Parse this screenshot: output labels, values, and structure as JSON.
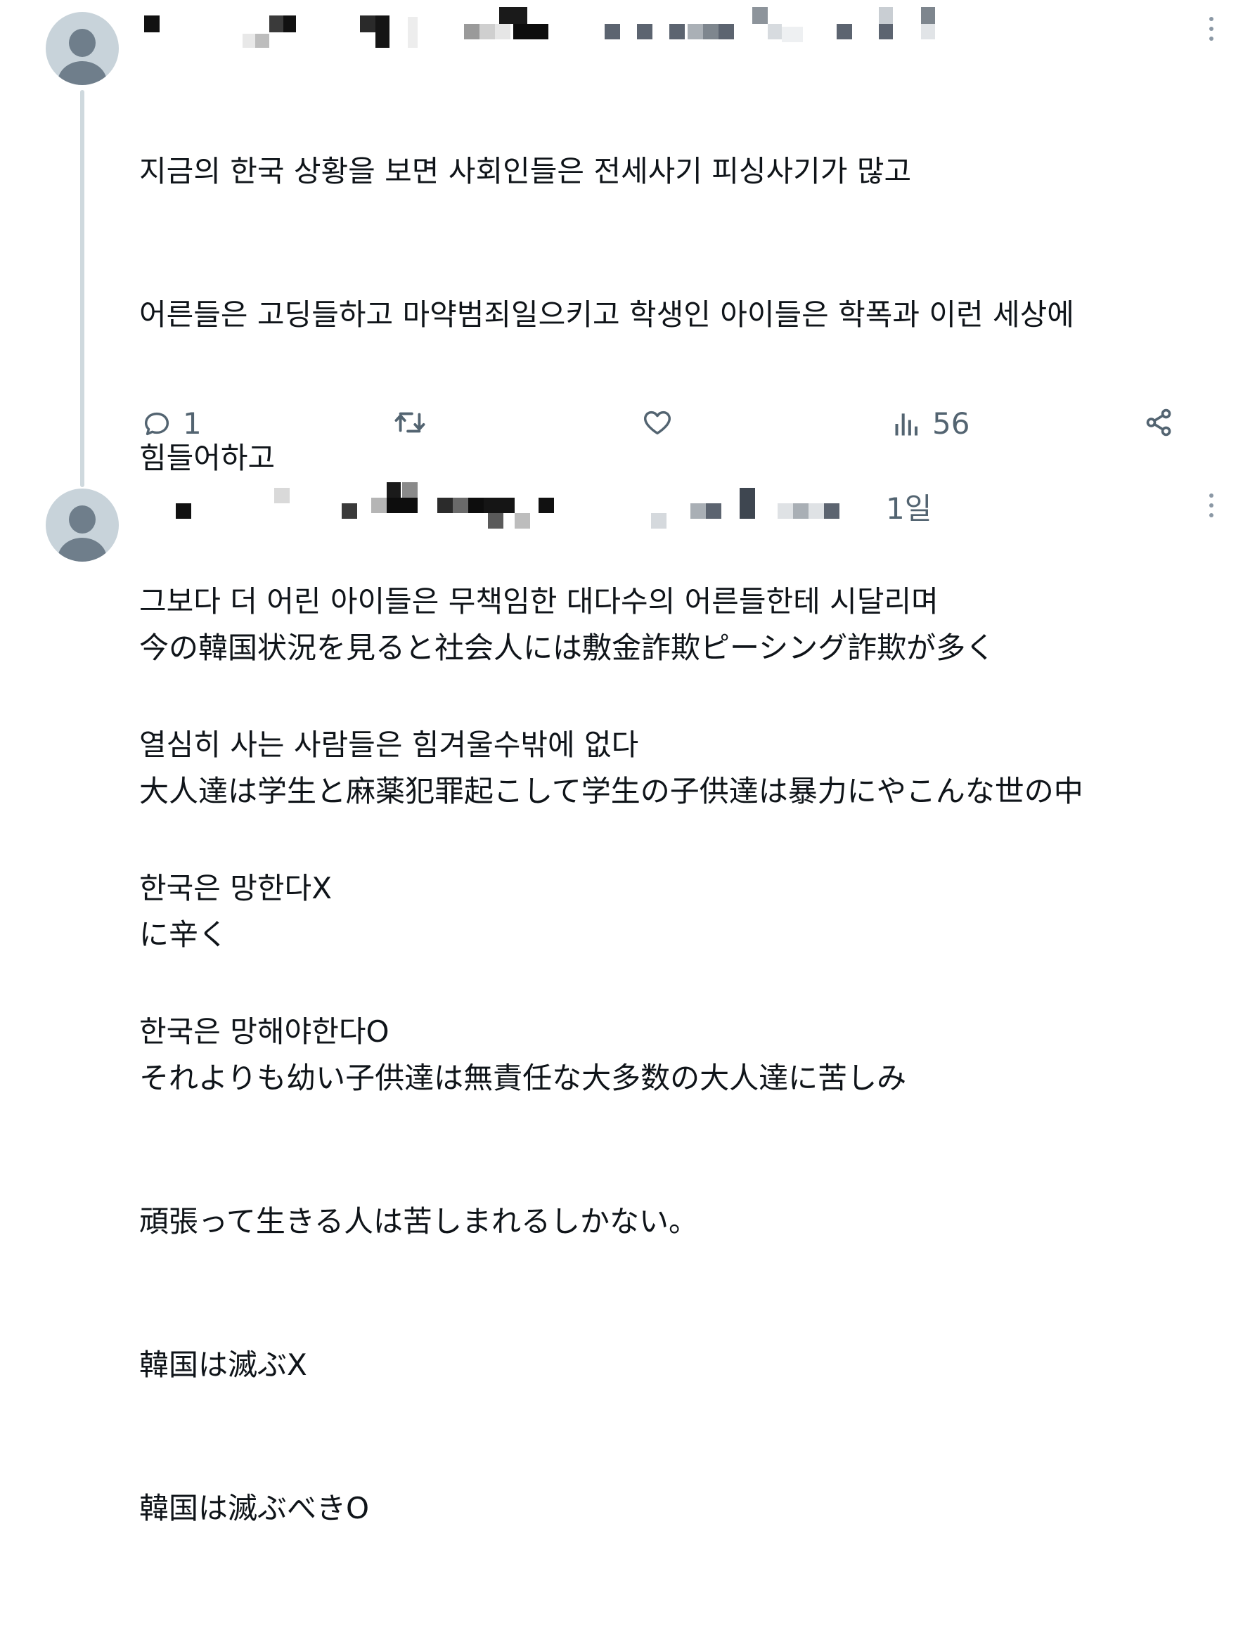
{
  "tweets": [
    {
      "lines": [
        "지금의 한국 상황을 보면 사회인들은 전세사기 피싱사기가 많고",
        "어른들은 고딩들하고 마약범죄일으키고 학생인 아이들은 학폭과 이런 세상에",
        "힘들어하고",
        "그보다 더 어린 아이들은 무책임한 대다수의 어른들한테 시달리며",
        "열심히 사는 사람들은 힘겨울수밖에 없다",
        "한국은 망한다X",
        "한국은 망해야한다O"
      ],
      "actions": {
        "reply_icon": "reply-icon",
        "reply_count": "1",
        "retweet_icon": "retweet-icon",
        "like_icon": "heart-icon",
        "views_icon": "views-icon",
        "views_count": "56",
        "share_icon": "share-icon"
      }
    },
    {
      "timestamp": "1일",
      "lines": [
        "今の韓国状況を見ると社会人には敷金詐欺ピーシング詐欺が多く",
        "大人達は学生と麻薬犯罪起こして学生の子供達は暴力にやこんな世の中",
        "に辛く",
        "それよりも幼い子供達は無責任な大多数の大人達に苦しみ",
        "頑張って生きる人は苦しまれるしかない。",
        "韓国は滅ぶX",
        "韓国は滅ぶべきO"
      ]
    }
  ],
  "colors": {
    "text": "#0f1419",
    "muted": "#536471",
    "thread_line": "#cfd9de",
    "avatar_bg": "#c8d3da",
    "avatar_fg": "#6f7e8b"
  }
}
